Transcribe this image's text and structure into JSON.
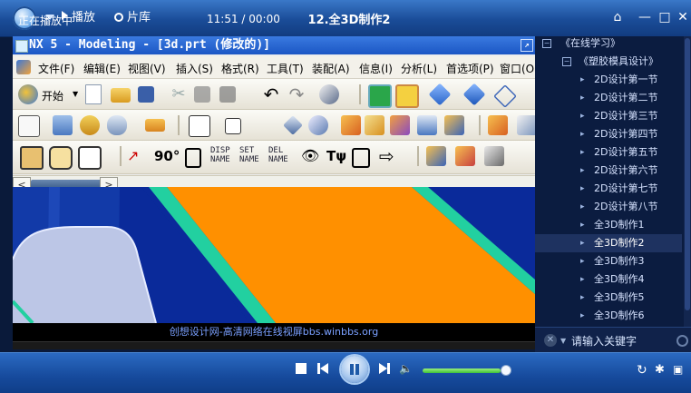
{
  "player": {
    "tabs": [
      "播放",
      "片库"
    ],
    "title": "12.全3D制作2",
    "window_buttons": [
      "⌂",
      "—",
      "□",
      "✕"
    ]
  },
  "nx": {
    "window_title": "NX 5 - Modeling - [3d.prt (修改的)]",
    "menu": [
      "文件(F)",
      "编辑(E)",
      "视图(V)",
      "插入(S)",
      "格式(R)",
      "工具(T)",
      "装配(A)",
      "信息(I)",
      "分析(L)",
      "首选项(P)",
      "窗口(O"
    ],
    "start_label": "开始",
    "toolbar3_text": [
      {
        "top": "DISP",
        "bottom": "NAME"
      },
      {
        "top": "SET",
        "bottom": "NAME"
      },
      {
        "top": "DEL",
        "bottom": "NAME"
      }
    ]
  },
  "video": {
    "subtitle": "创想设计网-高清网络在线视屏bbs.winbbs.org"
  },
  "playlist": {
    "root": "《在线学习》",
    "group": "《塑胶模具设计》",
    "items": [
      "2D设计第一节",
      "2D设计第二节",
      "2D设计第三节",
      "2D设计第四节",
      "2D设计第五节",
      "2D设计第六节",
      "2D设计第七节",
      "2D设计第八节",
      "全3D制作1",
      "全3D制作2",
      "全3D制作3",
      "全3D制作4",
      "全3D制作5",
      "全3D制作6"
    ],
    "selected_index": 9,
    "search_placeholder": "请输入关键字"
  },
  "controls": {
    "status": "正在播放中",
    "time": "11:51 / 00:00",
    "volume": 0.95
  },
  "colors": {
    "accent": "#1a4c98",
    "viewport_blue": "#0a2a9a",
    "viewport_orange": "#ff9000",
    "viewport_cyan": "#22d0a0"
  }
}
